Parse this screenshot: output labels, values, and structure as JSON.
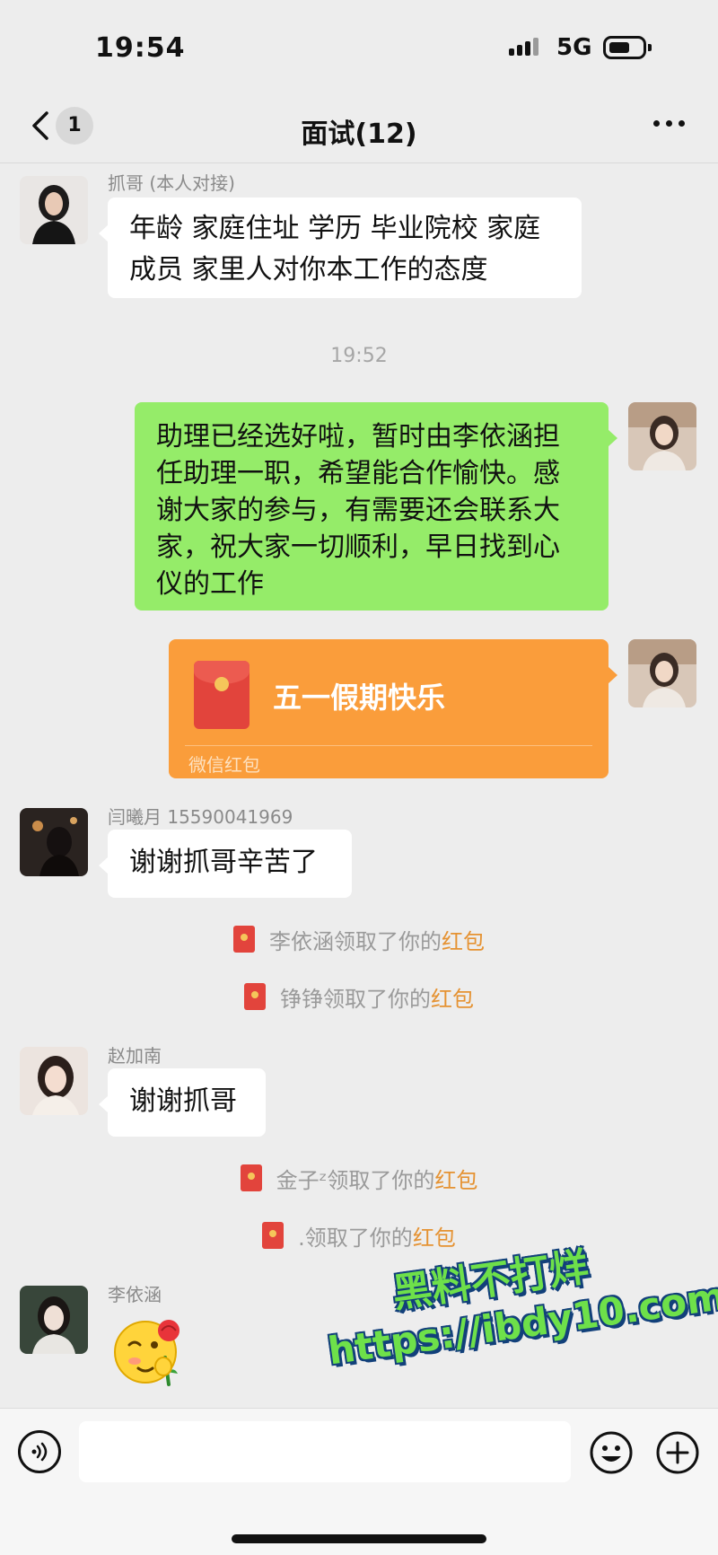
{
  "status": {
    "time": "19:54",
    "network": "5G"
  },
  "header": {
    "back_badge": "1",
    "title": "面试(12)"
  },
  "messages": {
    "m1": {
      "sender": "抓哥 (本人对接)",
      "line1": "年龄 家庭住址 学历 毕业院校 家庭",
      "line2": "成员 家里人对你本工作的态度"
    },
    "time_separator": "19:52",
    "m2": {
      "lines": [
        "助理已经选好啦，暂时由李依涵担",
        "任助理一职，希望能合作愉快。感",
        "谢大家的参与，有需要还会联系大",
        "家，祝大家一切顺利，早日找到心",
        "仪的工作"
      ]
    },
    "m3": {
      "title": "五一假期快乐",
      "footer": "微信红包"
    },
    "m4": {
      "sender": "闫曦月 15590041969",
      "text": "谢谢抓哥辛苦了"
    },
    "s1": {
      "text": "李依涵领取了你的",
      "link": "红包"
    },
    "s2": {
      "text": "铮铮领取了你的",
      "link": "红包"
    },
    "m5": {
      "sender": "赵加南",
      "text": "谢谢抓哥"
    },
    "s3": {
      "text": "金子ᶻ领取了你的",
      "link": "红包"
    },
    "s4": {
      "text": ".领取了你的",
      "link": "红包"
    },
    "m6": {
      "sender": "李依涵"
    }
  },
  "watermark": {
    "line1": "黑料不打烊",
    "line2": "https://ibdy10.com"
  },
  "icons": {
    "back": "chevron-left-icon",
    "more": "more-dots-icon",
    "voice": "voice-icon",
    "emoji": "emoji-face-icon",
    "add": "plus-circle-icon",
    "red_packet": "red-packet-icon"
  },
  "colors": {
    "green_bubble": "#95ec69",
    "red_packet": "#fa9d3b",
    "packet_link": "#e59232",
    "background": "#ededed"
  }
}
